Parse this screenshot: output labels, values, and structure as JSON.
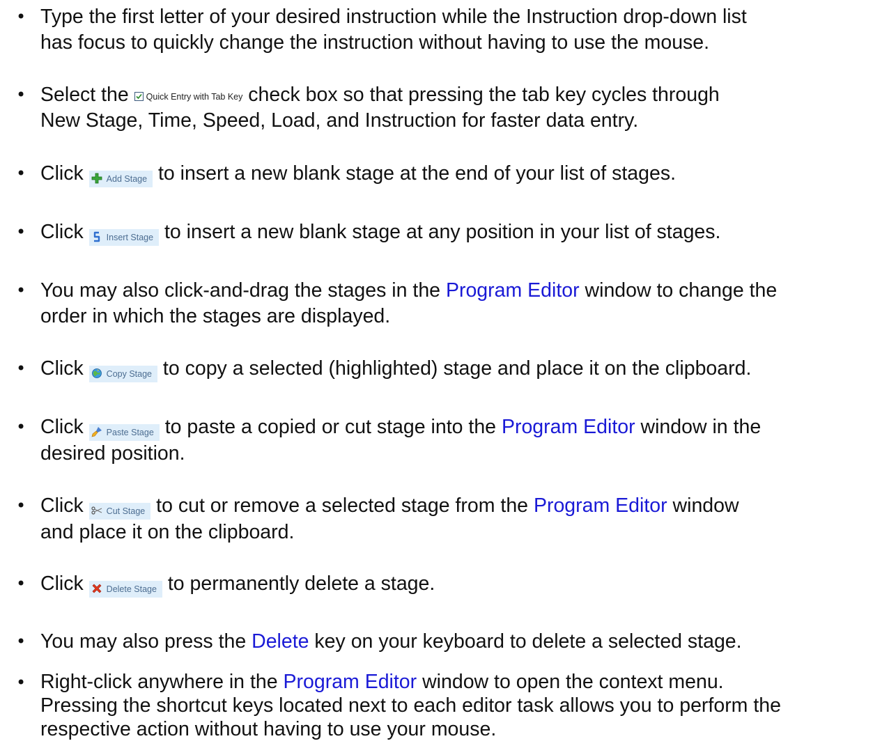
{
  "bullet_glyph": "•",
  "checkbox_label": "Quick Entry with Tab Key",
  "buttons": {
    "add_stage": {
      "label": "Add Stage",
      "icon": "green-plus-icon"
    },
    "insert_stage": {
      "label": "Insert Stage",
      "icon": "insert-arrow-icon"
    },
    "copy_stage": {
      "label": "Copy Stage",
      "icon": "copy-globe-icon"
    },
    "paste_stage": {
      "label": "Paste Stage",
      "icon": "paste-brush-icon"
    },
    "cut_stage": {
      "label": "Cut Stage",
      "icon": "scissors-icon"
    },
    "delete_stage": {
      "label": "Delete Stage",
      "icon": "red-x-icon"
    }
  },
  "colors": {
    "link_text": "#1a1ad6",
    "button_bg": "#dfeefa",
    "button_text": "#4c6d91"
  },
  "items": [
    {
      "line1": "Type the first letter of your desired instruction while the Instruction drop-down list",
      "line2": "has focus to quickly change the instruction without having to use the mouse."
    },
    {
      "pre": "Select the ",
      "post": " check box so that pressing the tab key cycles through",
      "line2": "New Stage, Time, Speed, Load, and Instruction for faster data entry."
    },
    {
      "pre": "Click ",
      "post": " to insert a new blank stage at the end of your list of stages."
    },
    {
      "pre": "Click ",
      "post": " to insert a new blank stage at any position in your list of stages."
    },
    {
      "pre": "You may also click-and-drag the stages in the ",
      "link": "Program Editor",
      "post": " window to change the",
      "line2": "order in which the stages are displayed."
    },
    {
      "pre": "Click ",
      "post": " to copy a selected (highlighted) stage and place it on the clipboard."
    },
    {
      "pre": "Click ",
      "mid": " to paste a copied or cut stage into the ",
      "link": "Program Editor",
      "post": " window in the",
      "line2": "desired position."
    },
    {
      "pre": "Click ",
      "mid": " to cut or remove a selected stage from the ",
      "link": "Program Editor",
      "post": " window",
      "line2": "and place it on the clipboard."
    },
    {
      "pre": "Click ",
      "post": " to permanently delete a stage."
    },
    {
      "pre": "You may also press the ",
      "link": "Delete",
      "post": " key on your keyboard to delete a selected stage."
    },
    {
      "pre": "Right-click anywhere in the ",
      "link": "Program Editor",
      "post": " window to open the context menu.",
      "line2": "Pressing the shortcut keys located next to each editor task allows you to perform the",
      "line3": "respective action without having to use your mouse."
    }
  ]
}
